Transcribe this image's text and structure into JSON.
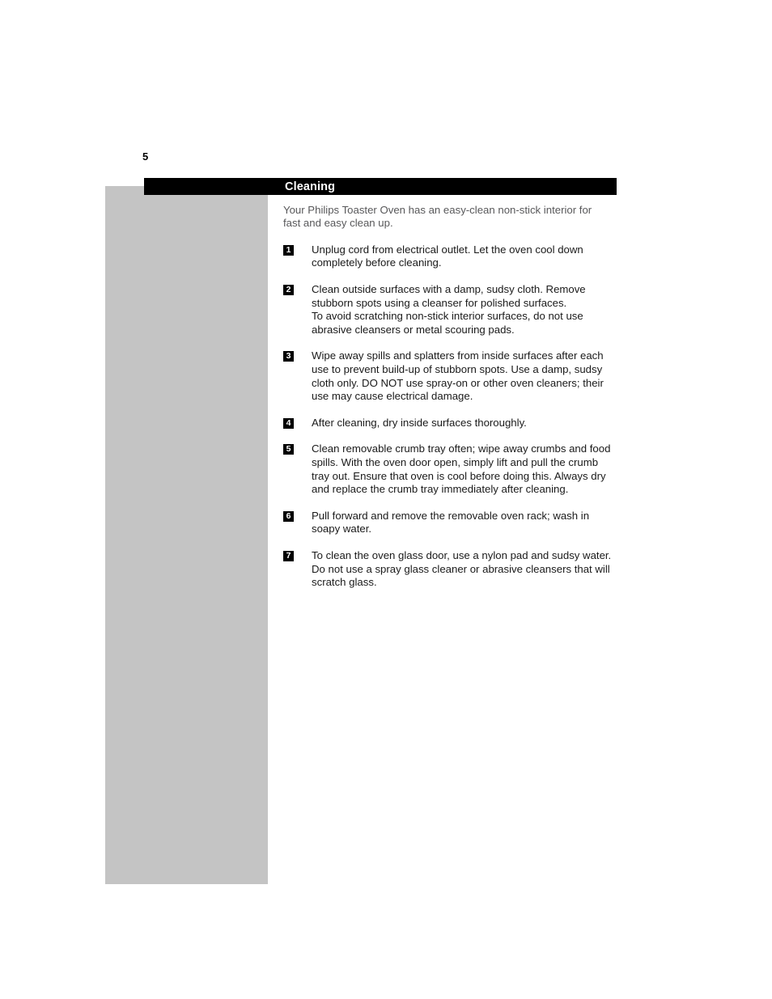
{
  "page": {
    "number": "5"
  },
  "section": {
    "title": "Cleaning"
  },
  "intro": {
    "text": "Your Philips Toaster Oven has an easy-clean non-stick interior for fast and easy clean up."
  },
  "steps": [
    {
      "number": "1",
      "text": "Unplug cord from electrical outlet. Let the oven cool down completely before cleaning."
    },
    {
      "number": "2",
      "text": "Clean outside surfaces with a damp, sudsy cloth. Remove stubborn spots using a cleanser for polished surfaces.\nTo avoid scratching non-stick interior surfaces, do not use abrasive cleansers or metal scouring pads."
    },
    {
      "number": "3",
      "text": "Wipe away spills and splatters from inside surfaces after each use to prevent build-up of stubborn spots. Use a damp, sudsy cloth only. DO NOT use spray-on or other oven cleaners; their use may cause electrical damage."
    },
    {
      "number": "4",
      "text": "After cleaning, dry inside surfaces thoroughly."
    },
    {
      "number": "5",
      "text": "Clean removable crumb tray often; wipe away crumbs and food spills. With the oven door open, simply lift and pull the crumb tray out. Ensure that oven is cool before doing this. Always dry and replace the crumb tray immediately after cleaning."
    },
    {
      "number": "6",
      "text": "Pull forward and remove the removable oven rack; wash in soapy water."
    },
    {
      "number": "7",
      "text": "To clean the oven glass door, use a nylon pad and sudsy water. Do not use a spray glass cleaner or abrasive cleansers that will scratch glass."
    }
  ],
  "colors": {
    "bar": "#000000",
    "side_panel": "#c4c4c4",
    "intro_text": "#58585a",
    "body_text": "#1a1a1a"
  }
}
